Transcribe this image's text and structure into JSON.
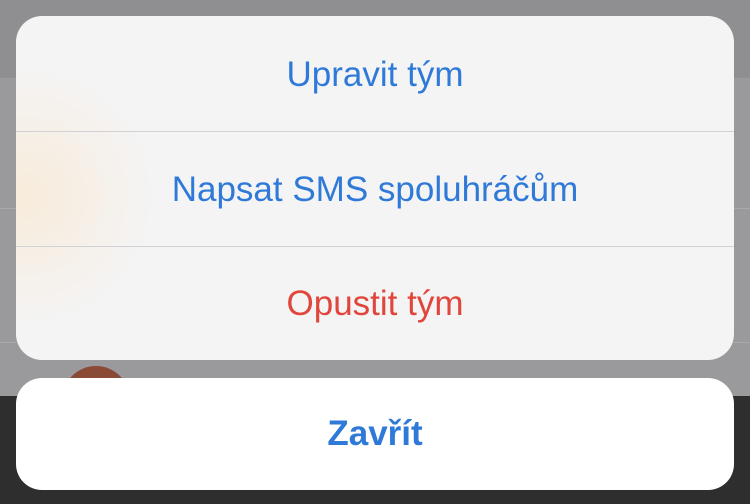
{
  "action_sheet": {
    "actions": [
      {
        "label": "Upravit tým",
        "style": "default"
      },
      {
        "label": "Napsat SMS spoluhráčům",
        "style": "default"
      },
      {
        "label": "Opustit tým",
        "style": "destructive"
      }
    ],
    "cancel_label": "Zavřít"
  },
  "colors": {
    "action_blue": "#2f7ad8",
    "destructive_red": "#e0463b",
    "sheet_background": "#f7f7f8",
    "dimmed_overlay": "#8e8e90"
  }
}
